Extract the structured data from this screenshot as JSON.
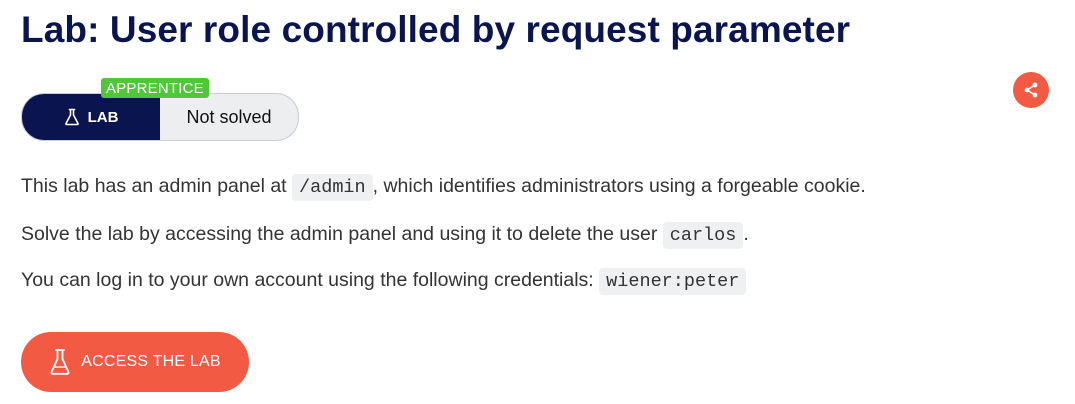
{
  "header": {
    "title": "Lab: User role controlled by request parameter"
  },
  "share": {
    "icon": "share-icon",
    "color": "#f25a44"
  },
  "status": {
    "level": "APPRENTICE",
    "lab_label": "LAB",
    "lab_icon": "flask-icon",
    "state": "Not solved",
    "colors": {
      "lab_bg": "#0a1550",
      "level_bg": "#4fc739"
    }
  },
  "description": {
    "line1": {
      "before": "This lab has an admin panel at ",
      "code": "/admin",
      "after": ", which identifies administrators using a forgeable cookie."
    },
    "line2": {
      "before": "Solve the lab by accessing the admin panel and using it to delete the user ",
      "code": "carlos",
      "after": "."
    },
    "line3": {
      "before": "You can log in to your own account using the following credentials: ",
      "code": "wiener:peter",
      "after": ""
    }
  },
  "access_button": {
    "label": "ACCESS THE LAB",
    "icon": "flask-icon",
    "color": "#f25a44"
  }
}
